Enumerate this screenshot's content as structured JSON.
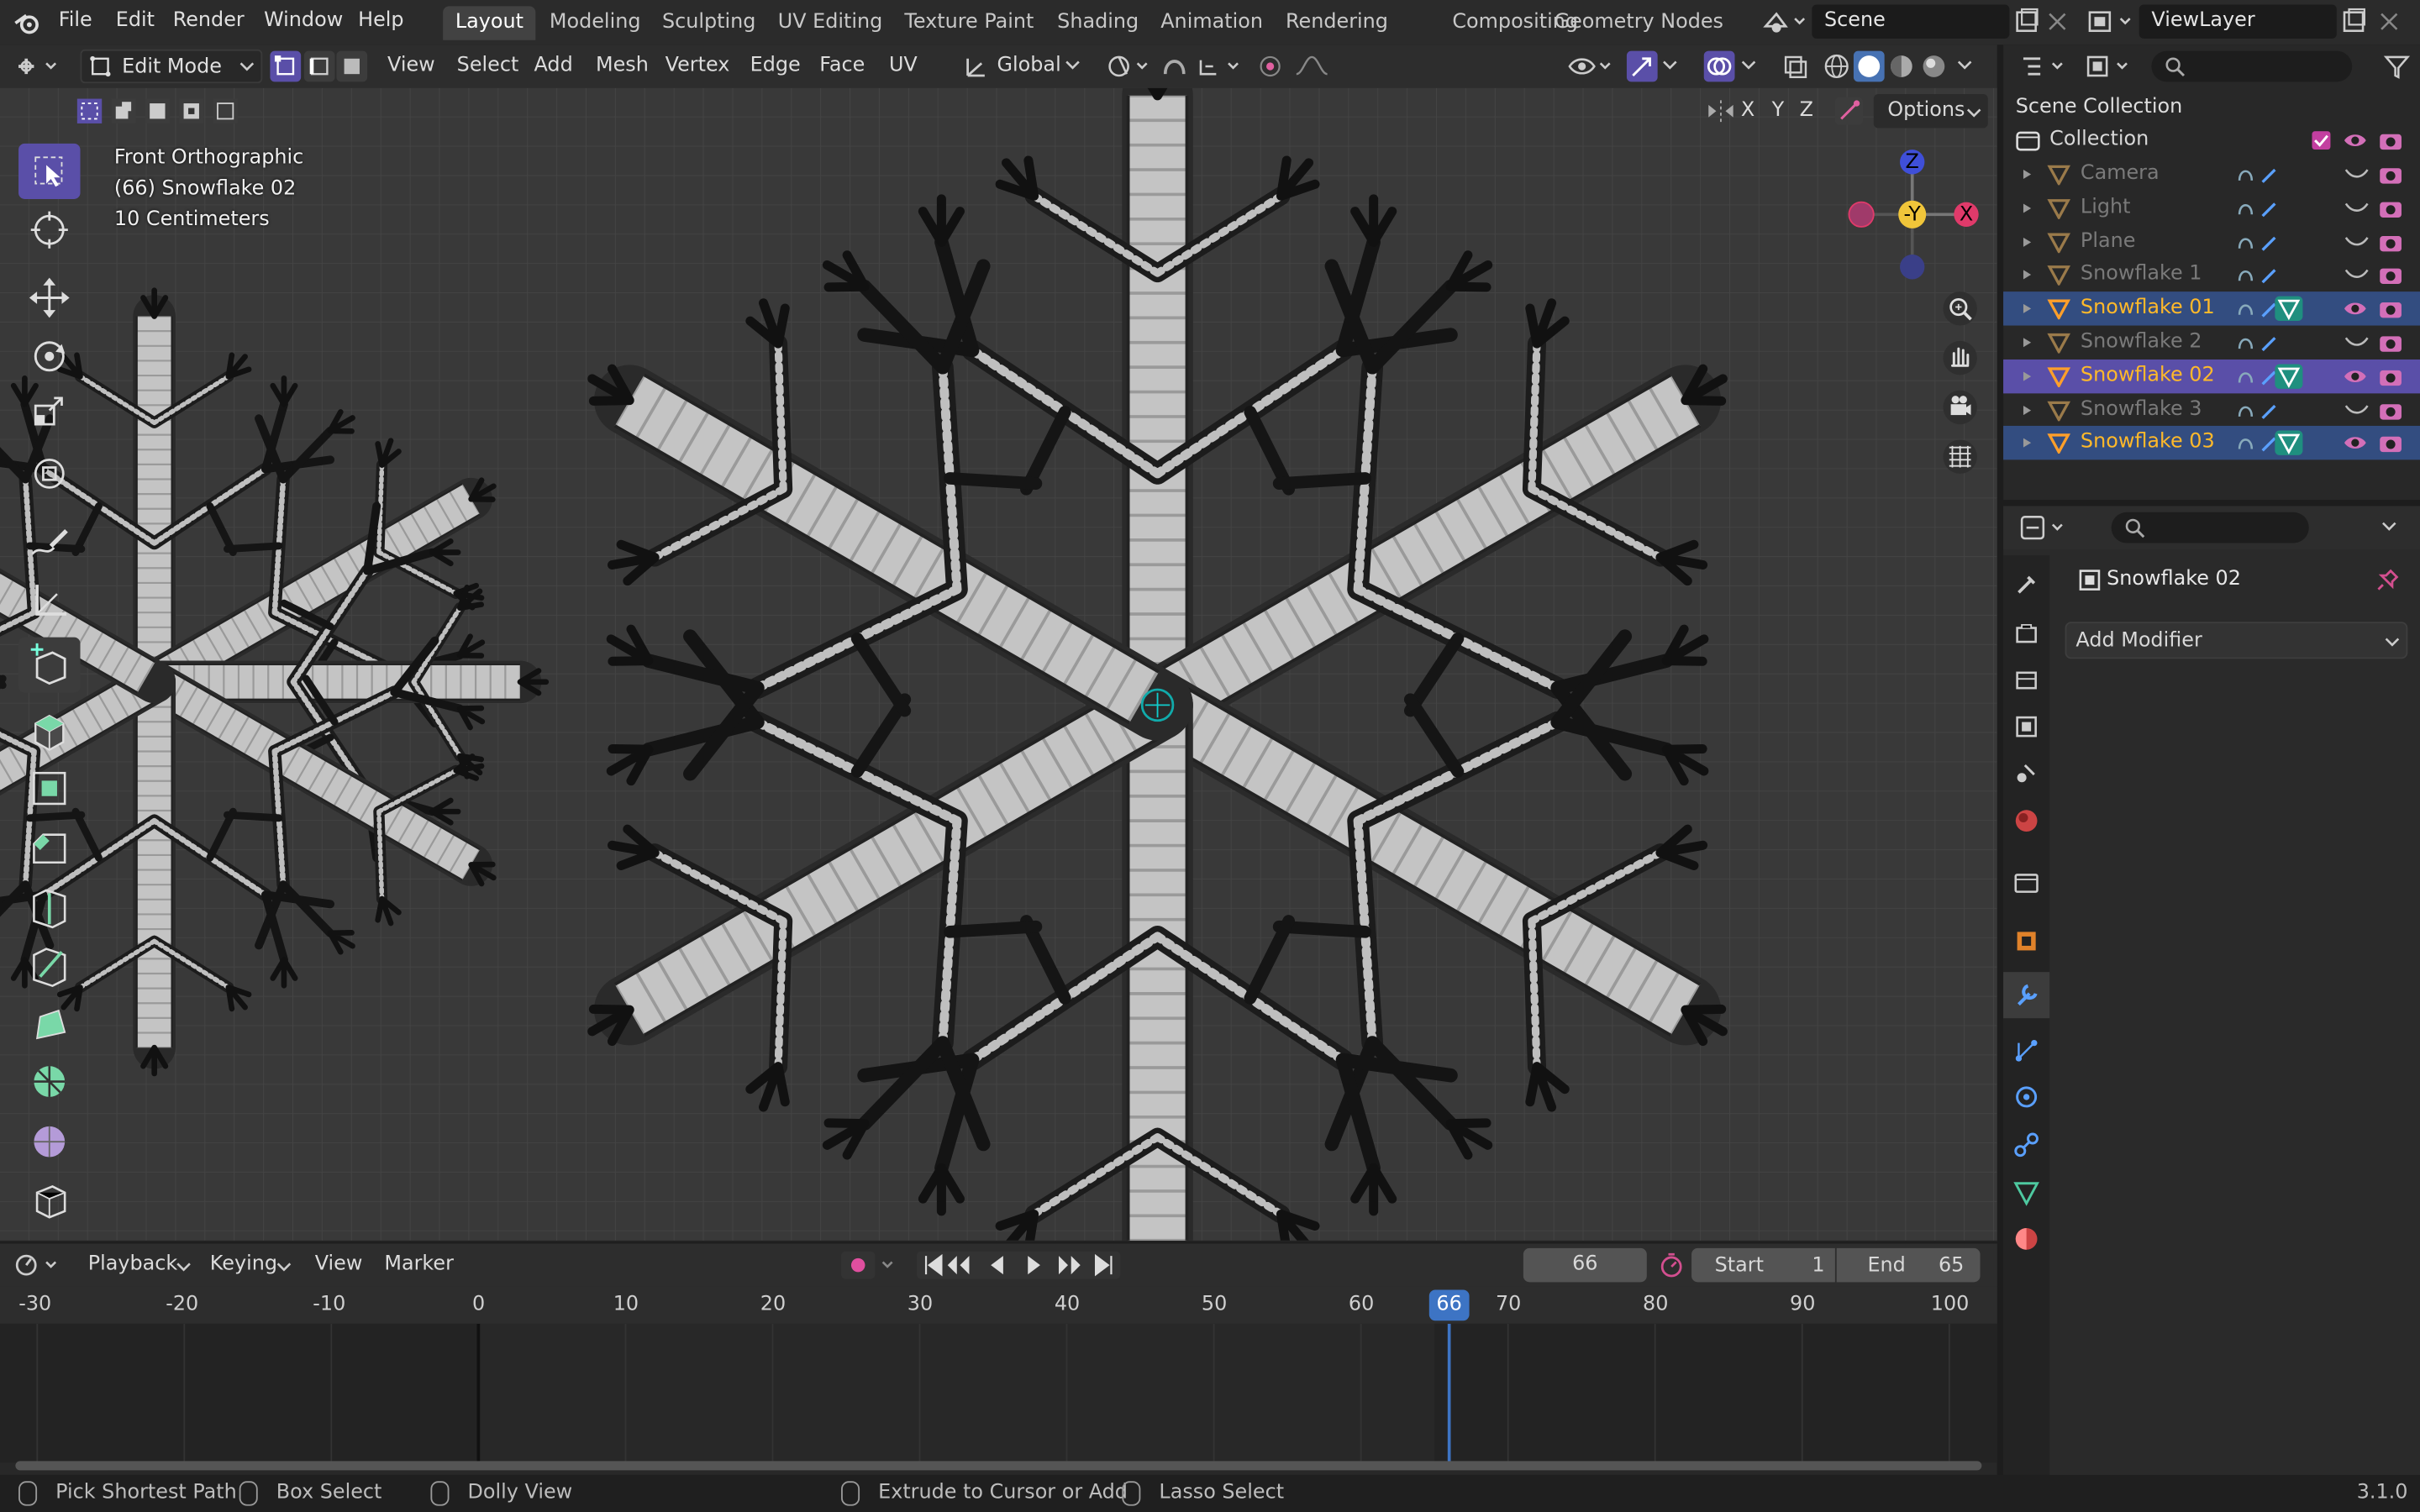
{
  "menu": {
    "file": "File",
    "edit": "Edit",
    "render": "Render",
    "window": "Window",
    "help": "Help"
  },
  "workspaces": [
    "Layout",
    "Modeling",
    "Sculpting",
    "UV Editing",
    "Texture Paint",
    "Shading",
    "Animation",
    "Rendering",
    "Compositing",
    "Geometry Nodes"
  ],
  "scene_name": "Scene",
  "view_layer": "ViewLayer",
  "viewport_header": {
    "mode": "Edit Mode",
    "menus": [
      "View",
      "Select",
      "Add",
      "Mesh",
      "Vertex",
      "Edge",
      "Face",
      "UV"
    ],
    "transform_orientation": "Global",
    "options_label": "Options",
    "axes": [
      "X",
      "Y",
      "Z"
    ]
  },
  "viewport_overlay": {
    "view_name": "Front Orthographic",
    "object_info": "(66) Snowflake 02",
    "scale": "10 Centimeters"
  },
  "gizmo": {
    "z": "Z",
    "y": "-Y",
    "x": "X"
  },
  "outliner": {
    "root": "Scene Collection",
    "collection": "Collection",
    "items": [
      {
        "name": "Camera",
        "state": "dim"
      },
      {
        "name": "Light",
        "state": "dim"
      },
      {
        "name": "Plane",
        "state": "dim"
      },
      {
        "name": "Snowflake 1",
        "state": "dim"
      },
      {
        "name": "Snowflake 01",
        "state": "selected"
      },
      {
        "name": "Snowflake 2",
        "state": "dim"
      },
      {
        "name": "Snowflake 02",
        "state": "active"
      },
      {
        "name": "Snowflake 3",
        "state": "dim"
      },
      {
        "name": "Snowflake 03",
        "state": "selected"
      }
    ]
  },
  "properties": {
    "object_name": "Snowflake 02",
    "add_modifier": "Add Modifier"
  },
  "timeline": {
    "menus": [
      "Playback",
      "Keying",
      "View",
      "Marker"
    ],
    "current_frame": "66",
    "start_label": "Start",
    "start": "1",
    "end_label": "End",
    "end": "65",
    "ruler": [
      "-30",
      "-20",
      "-10",
      "0",
      "10",
      "20",
      "30",
      "40",
      "50",
      "60",
      "70",
      "80",
      "90",
      "100"
    ],
    "playhead": "66"
  },
  "statusbar": {
    "items": [
      "Pick Shortest Path",
      "Box Select",
      "Dolly View",
      "Extrude to Cursor or Add",
      "Lasso Select"
    ],
    "version": "3.1.0"
  },
  "colors": {
    "accent": "#5a4fa8",
    "selected_row": "#334d80",
    "orange": "#ffa733",
    "playhead": "#3d74c4"
  }
}
